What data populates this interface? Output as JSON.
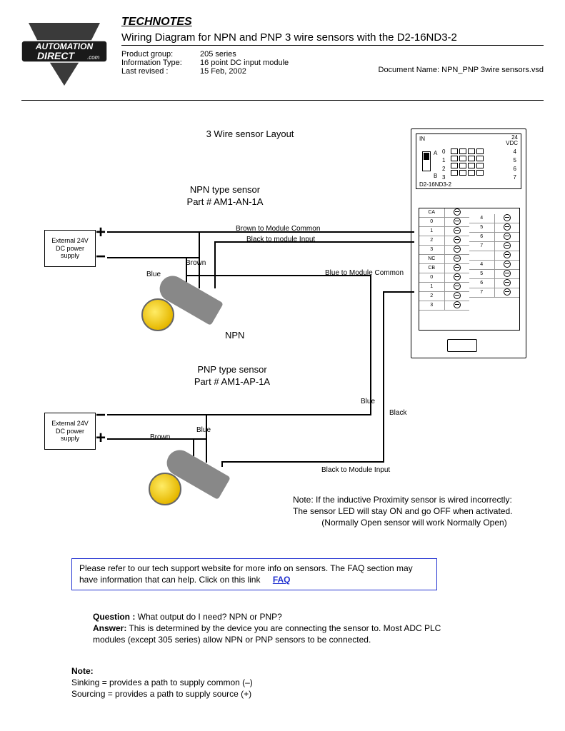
{
  "header": {
    "technotes": "TECHNOTES",
    "title": "Wiring Diagram for NPN and PNP 3 wire sensors with the D2-16ND3-2",
    "meta": [
      {
        "label": "Product group:",
        "value": "205 series"
      },
      {
        "label": "Information Type:",
        "value": "16 point DC input module"
      },
      {
        "label": "Last revised :",
        "value": "15 Feb, 2002"
      }
    ],
    "docname": "Document Name: NPN_PNP 3wire sensors.vsd",
    "logo_line1": "AUTOMATION",
    "logo_line2": "DIRECT",
    "logo_suffix": ".com"
  },
  "diagram": {
    "layout_title": "3 Wire sensor Layout",
    "npn": {
      "title_l1": "NPN type sensor",
      "title_l2": "Part # AM1-AN-1A",
      "psu": "External 24V\nDC power\nsupply",
      "blue": "Blue",
      "brown": "Brown",
      "brown_to_common": "Brown to Module Common",
      "black_to_input": "Black to module Input",
      "blue_to_common": "Blue to Module Common",
      "label": "NPN"
    },
    "pnp": {
      "title_l1": "PNP type sensor",
      "title_l2": "Part # AM1-AP-1A",
      "psu": "External 24V\nDC power\nsupply",
      "blue_v": "Blue",
      "blue_h": "Blue",
      "brown": "Brown",
      "black": "Black",
      "black_to_input": "Black to Module Input",
      "note_l1": "Note: If the inductive Proximity sensor is wired incorrectly:",
      "note_l2": "The sensor LED will stay ON and go OFF when activated.",
      "note_l3": "(Normally Open sensor will work Normally Open)"
    },
    "module": {
      "in": "IN",
      "vdc_l1": "24",
      "vdc_l2": "VDC",
      "a": "A",
      "b": "B",
      "nums_left": [
        "0",
        "1",
        "2",
        "3"
      ],
      "nums_right": [
        "4",
        "5",
        "6",
        "7"
      ],
      "part": "D2-16ND3-2",
      "term_top": [
        "CA",
        "0",
        "4",
        "1",
        "5",
        "2",
        "6",
        "3",
        "7",
        "NC"
      ],
      "term_bot": [
        "CB",
        "0",
        "4",
        "1",
        "5",
        "2",
        "6",
        "3",
        "7"
      ]
    }
  },
  "info_box": {
    "text": "Please refer to our tech support website for more info on sensors.  The FAQ section may have information that can help.  Click on this link",
    "faq": "FAQ"
  },
  "qa": {
    "q_label": "Question :",
    "q_text": " What output do I need? NPN or PNP?",
    "a_label": "Answer:",
    "a_text": " This is determined by the device you are connecting the sensor to. Most ADC PLC modules (except 305 series) allow NPN or PNP sensors to be connected."
  },
  "note": {
    "heading": "Note:",
    "l1": "Sinking = provides a path to supply common (–)",
    "l2": "Sourcing = provides a path to supply source (+)"
  }
}
